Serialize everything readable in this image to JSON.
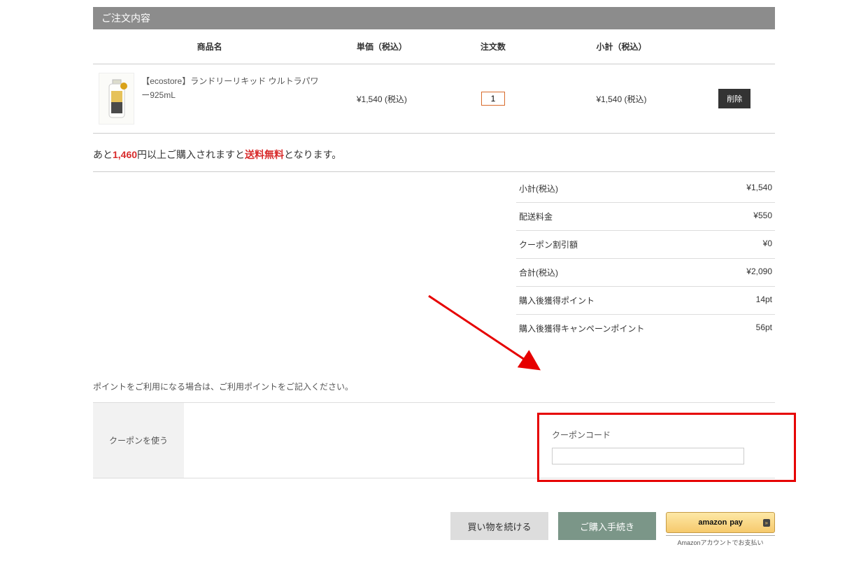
{
  "header": {
    "title": "ご注文内容"
  },
  "table": {
    "columns": {
      "product": "商品名",
      "unit_price": "単価（税込）",
      "qty": "注文数",
      "subtotal": "小計（税込）"
    },
    "rows": [
      {
        "name": "【ecostore】ランドリーリキッド ウルトラパワー925mL",
        "price": "¥1,540 (税込)",
        "qty": "1",
        "subtotal": "¥1,540 (税込)",
        "delete_label": "削除"
      }
    ]
  },
  "free_shipping": {
    "prefix": "あと",
    "amount": "1,460",
    "mid": "円以上ご購入されますと",
    "keyword": "送料無料",
    "suffix": "となります。"
  },
  "totals": [
    {
      "label": "小計(税込)",
      "value": "¥1,540"
    },
    {
      "label": "配送料金",
      "value": "¥550"
    },
    {
      "label": "クーポン割引額",
      "value": "¥0"
    },
    {
      "label": "合計(税込)",
      "value": "¥2,090"
    },
    {
      "label": "購入後獲得ポイント",
      "value": "14pt"
    },
    {
      "label": "購入後獲得キャンペーンポイント",
      "value": "56pt"
    }
  ],
  "point_note": "ポイントをご利用になる場合は、ご利用ポイントをご記入ください。",
  "coupon": {
    "section_label": "クーポンを使う",
    "field_label": "クーポンコード",
    "value": ""
  },
  "buttons": {
    "continue": "買い物を続ける",
    "purchase": "ご購入手続き",
    "amazon_logo": "amazon",
    "amazon_pay": "pay",
    "amazon_chev": "»",
    "amazon_caption": "Amazonアカウントでお支払い"
  },
  "annotation": {
    "arrow_color": "#e60000"
  }
}
